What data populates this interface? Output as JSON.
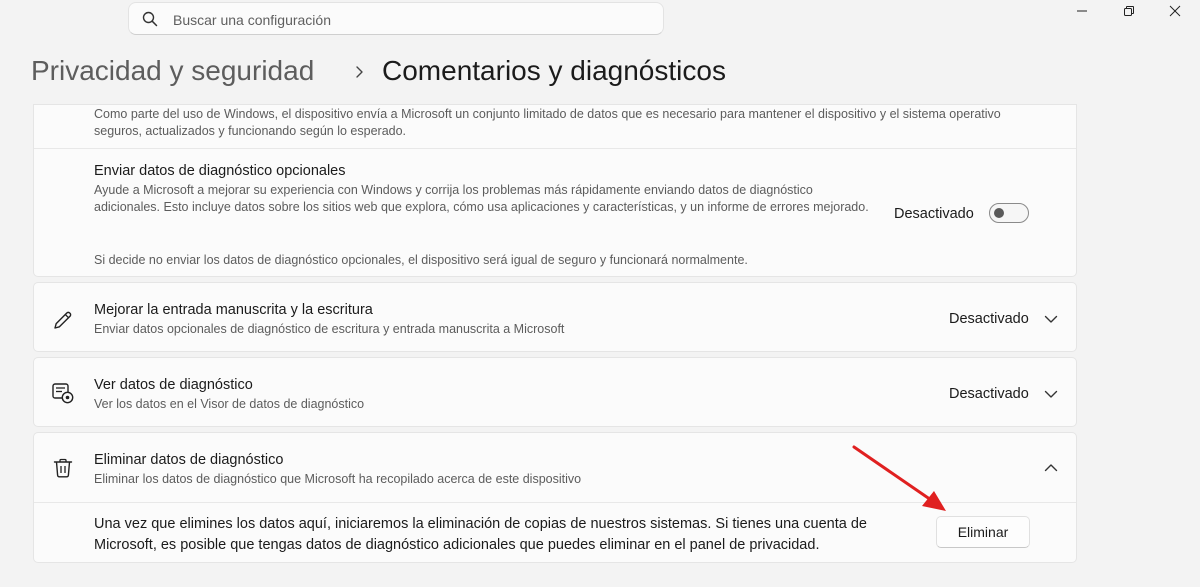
{
  "search": {
    "placeholder": "Buscar una configuración"
  },
  "breadcrumb": {
    "parent": "Privacidad y seguridad",
    "current": "Comentarios y diagnósticos"
  },
  "required_data": {
    "description": "Como parte del uso de Windows, el dispositivo envía a Microsoft un conjunto limitado de datos que es necesario para mantener el dispositivo y el sistema operativo seguros, actualizados y funcionando según lo esperado."
  },
  "optional_data": {
    "title": "Enviar datos de diagnóstico opcionales",
    "description": "Ayude a Microsoft a mejorar su experiencia con Windows y corrija los problemas más rápidamente enviando datos de diagnóstico adicionales. Esto incluye datos sobre los sitios web que explora, cómo usa aplicaciones y características, y un informe de errores mejorado.",
    "note": "Si decide no enviar los datos de diagnóstico opcionales, el dispositivo será igual de seguro y funcionará normalmente.",
    "state": "Desactivado",
    "toggle_on": false
  },
  "inking": {
    "title": "Mejorar la entrada manuscrita y la escritura",
    "subtitle": "Enviar datos opcionales de diagnóstico de escritura y entrada manuscrita a Microsoft",
    "state": "Desactivado",
    "icon": "pen-icon"
  },
  "view_data": {
    "title": "Ver datos de diagnóstico",
    "subtitle": "Ver los datos en el Visor de datos de diagnóstico",
    "state": "Desactivado",
    "icon": "diagnostic-viewer-icon"
  },
  "delete_data": {
    "title": "Eliminar datos de diagnóstico",
    "subtitle": "Eliminar los datos de diagnóstico que Microsoft ha recopilado acerca de este dispositivo",
    "body": "Una vez que elimines los datos aquí, iniciaremos la eliminación de copias de nuestros sistemas. Si tienes una cuenta de Microsoft, es posible que tengas datos de diagnóstico adicionales que puedes eliminar en el panel de privacidad.",
    "button": "Eliminar",
    "icon": "trash-icon"
  },
  "colors": {
    "annotation_arrow": "#e02020",
    "background": "#f3f3f3",
    "card": "#fbfbfb"
  }
}
